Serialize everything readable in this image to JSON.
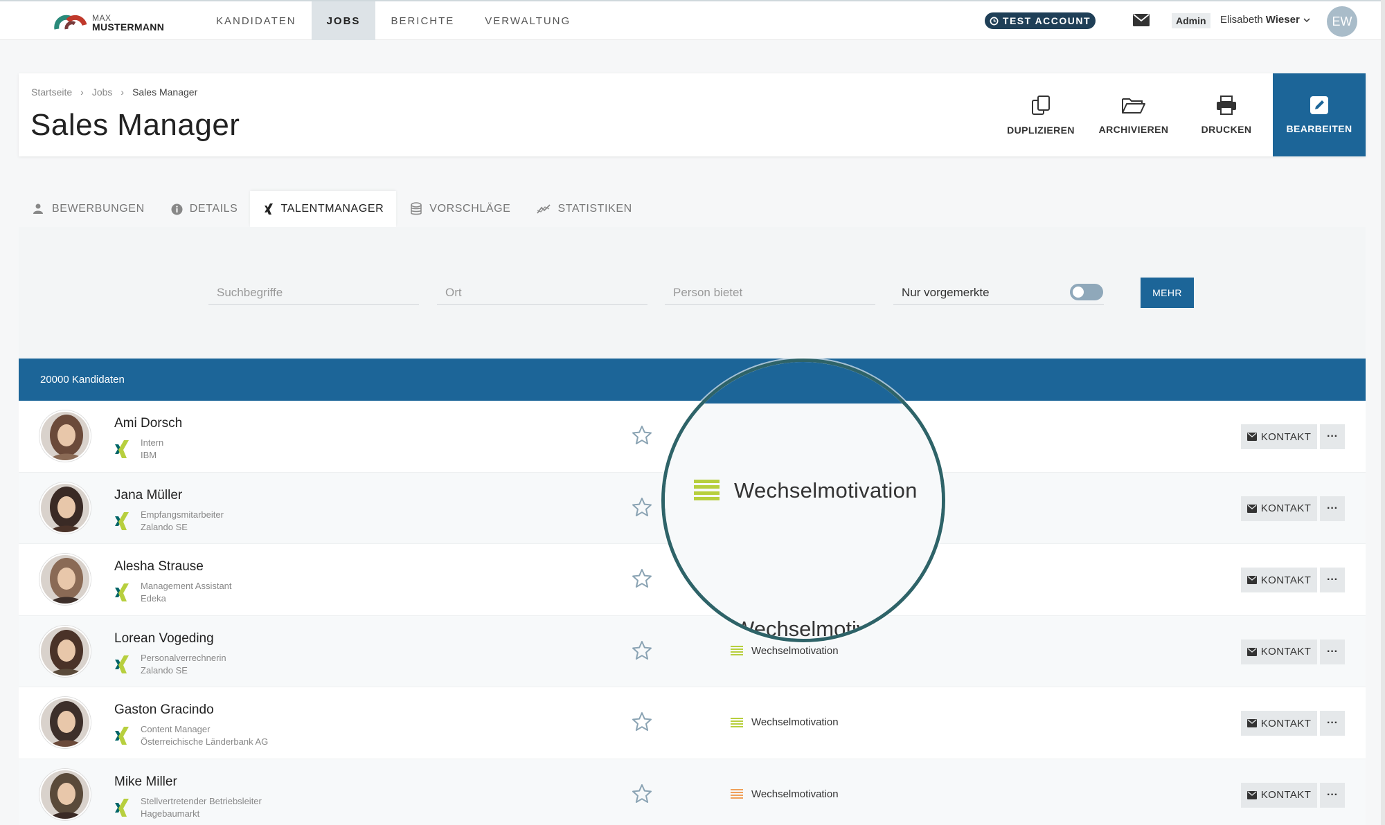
{
  "header": {
    "logo_line1": "MAX",
    "logo_line2": "MUSTERMANN",
    "nav": [
      "KANDIDATEN",
      "JOBS",
      "BERICHTE",
      "VERWALTUNG"
    ],
    "active_nav": "JOBS",
    "test_badge": "TEST ACCOUNT",
    "role": "Admin",
    "user_first": "Elisabeth",
    "user_last": "Wieser",
    "avatar_initials": "EW"
  },
  "breadcrumb": [
    "Startseite",
    "Jobs",
    "Sales Manager"
  ],
  "page_title": "Sales Manager",
  "actions": {
    "duplicate": "DUPLIZIEREN",
    "archive": "ARCHIVIEREN",
    "print": "DRUCKEN",
    "edit": "BEARBEITEN"
  },
  "tabs": [
    "BEWERBUNGEN",
    "DETAILS",
    "TALENTMANAGER",
    "VORSCHLÄGE",
    "STATISTIKEN"
  ],
  "active_tab": "TALENTMANAGER",
  "filters": {
    "search_placeholder": "Suchbegriffe",
    "location_placeholder": "Ort",
    "offers_placeholder": "Person bietet",
    "only_marked_label": "Nur vorgemerkte",
    "only_marked_on": false,
    "more_button": "MEHR"
  },
  "results": {
    "count_label": "20000 Kandidaten"
  },
  "candidates": [
    {
      "name": "Ami Dorsch",
      "title": "Intern",
      "company": "IBM",
      "motivation": "",
      "motivation_color": ""
    },
    {
      "name": "Jana Müller",
      "title": "Empfangsmitarbeiter",
      "company": "Zalando SE",
      "motivation": "",
      "motivation_color": ""
    },
    {
      "name": "Alesha Strause",
      "title": "Management Assistant",
      "company": "Edeka",
      "motivation": "",
      "motivation_color": ""
    },
    {
      "name": "Lorean Vogeding",
      "title": "Personalverrechnerin",
      "company": "Zalando SE",
      "motivation": "Wechselmotivation",
      "motivation_color": "#b7cf3e"
    },
    {
      "name": "Gaston Gracindo",
      "title": "Content Manager",
      "company": "Österreichische Länderbank AG",
      "motivation": "Wechselmotivation",
      "motivation_color": "#b7cf3e"
    },
    {
      "name": "Mike Miller",
      "title": "Stellvertretender Betriebsleiter",
      "company": "Hagebaumarkt",
      "motivation": "Wechselmotivation",
      "motivation_color": "#f0a05a"
    }
  ],
  "row_actions": {
    "contact": "KONTAKT",
    "more": "···"
  },
  "magnifier": {
    "label": "Wechselmotivation",
    "bottom_label": "Wechselmotivat",
    "color": "#b7cf3e"
  },
  "colors": {
    "primary": "#1c6598",
    "badge": "#1f3f57",
    "xing_green": "#b7cf3e",
    "xing_teal": "#006567"
  }
}
